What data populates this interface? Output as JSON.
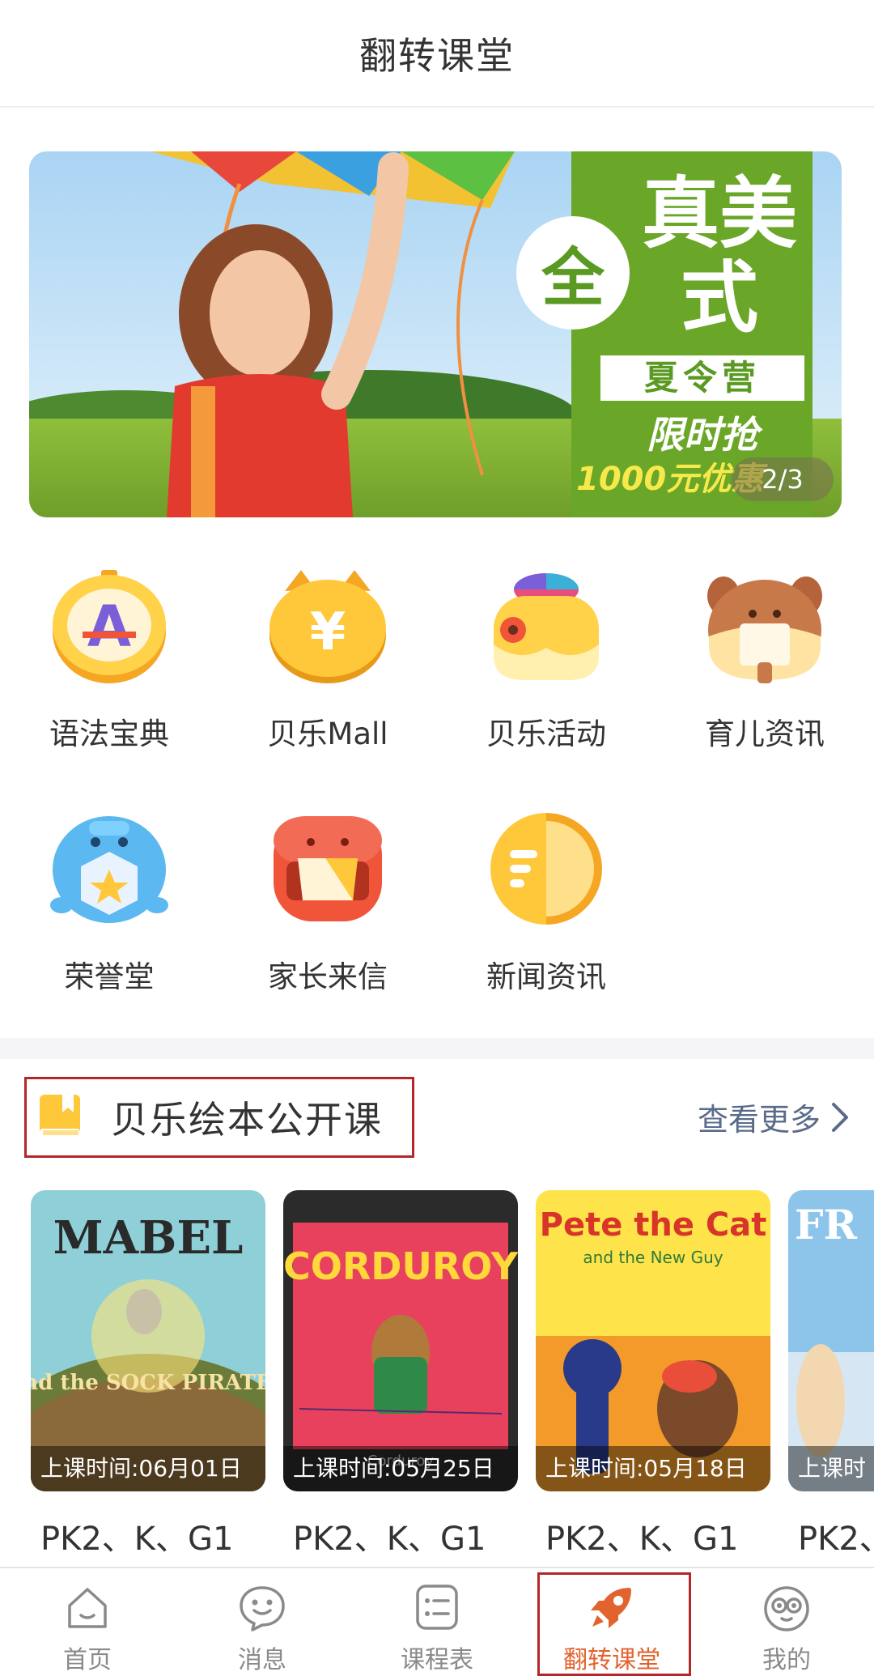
{
  "header": {
    "title": "翻转课堂"
  },
  "banner": {
    "promo_circle": "全",
    "promo_title": "真美式",
    "promo_subtitle": "夏令营",
    "promo_offer": "限时抢",
    "promo_discount": "1000元优惠",
    "pager": "2/3",
    "colors": {
      "promo_green": "#6aa628",
      "promo_yellow": "#f7e94b"
    }
  },
  "grid": {
    "items": [
      {
        "label": "语法宝典",
        "icon": "grammar-book-icon"
      },
      {
        "label": "贝乐Mall",
        "icon": "mall-icon"
      },
      {
        "label": "贝乐活动",
        "icon": "activity-icon"
      },
      {
        "label": "育儿资讯",
        "icon": "parenting-news-icon"
      },
      {
        "label": "荣誉堂",
        "icon": "honor-hall-icon"
      },
      {
        "label": "家长来信",
        "icon": "parent-letter-icon"
      },
      {
        "label": "新闻资讯",
        "icon": "news-icon"
      }
    ]
  },
  "section": {
    "title": "贝乐绘本公开课",
    "see_more": "查看更多",
    "accent": "#b3262a"
  },
  "courses": [
    {
      "cover_title": "MABEL",
      "cover_subtitle": "and the SOCK PIRATES",
      "date": "上课时间:06月01日",
      "grade": "PK2、K、G1"
    },
    {
      "cover_title": "CORDUROY",
      "cover_subtitle": "Corduroy",
      "date": "上课时间:05月25日",
      "grade": "PK2、K、G1"
    },
    {
      "cover_title": "Pete the Cat",
      "cover_subtitle": "and the New Guy",
      "date": "上课时间:05月18日",
      "grade": "PK2、K、G1"
    },
    {
      "cover_title": "FR",
      "cover_subtitle": "",
      "date": "上课时",
      "grade": "PK2、"
    }
  ],
  "tabbar": {
    "tabs": [
      {
        "label": "首页",
        "icon": "home-icon",
        "active": false
      },
      {
        "label": "消息",
        "icon": "message-icon",
        "active": false
      },
      {
        "label": "课程表",
        "icon": "schedule-icon",
        "active": false
      },
      {
        "label": "翻转课堂",
        "icon": "rocket-icon",
        "active": true
      },
      {
        "label": "我的",
        "icon": "profile-icon",
        "active": false
      }
    ],
    "active_color": "#e2632e"
  }
}
